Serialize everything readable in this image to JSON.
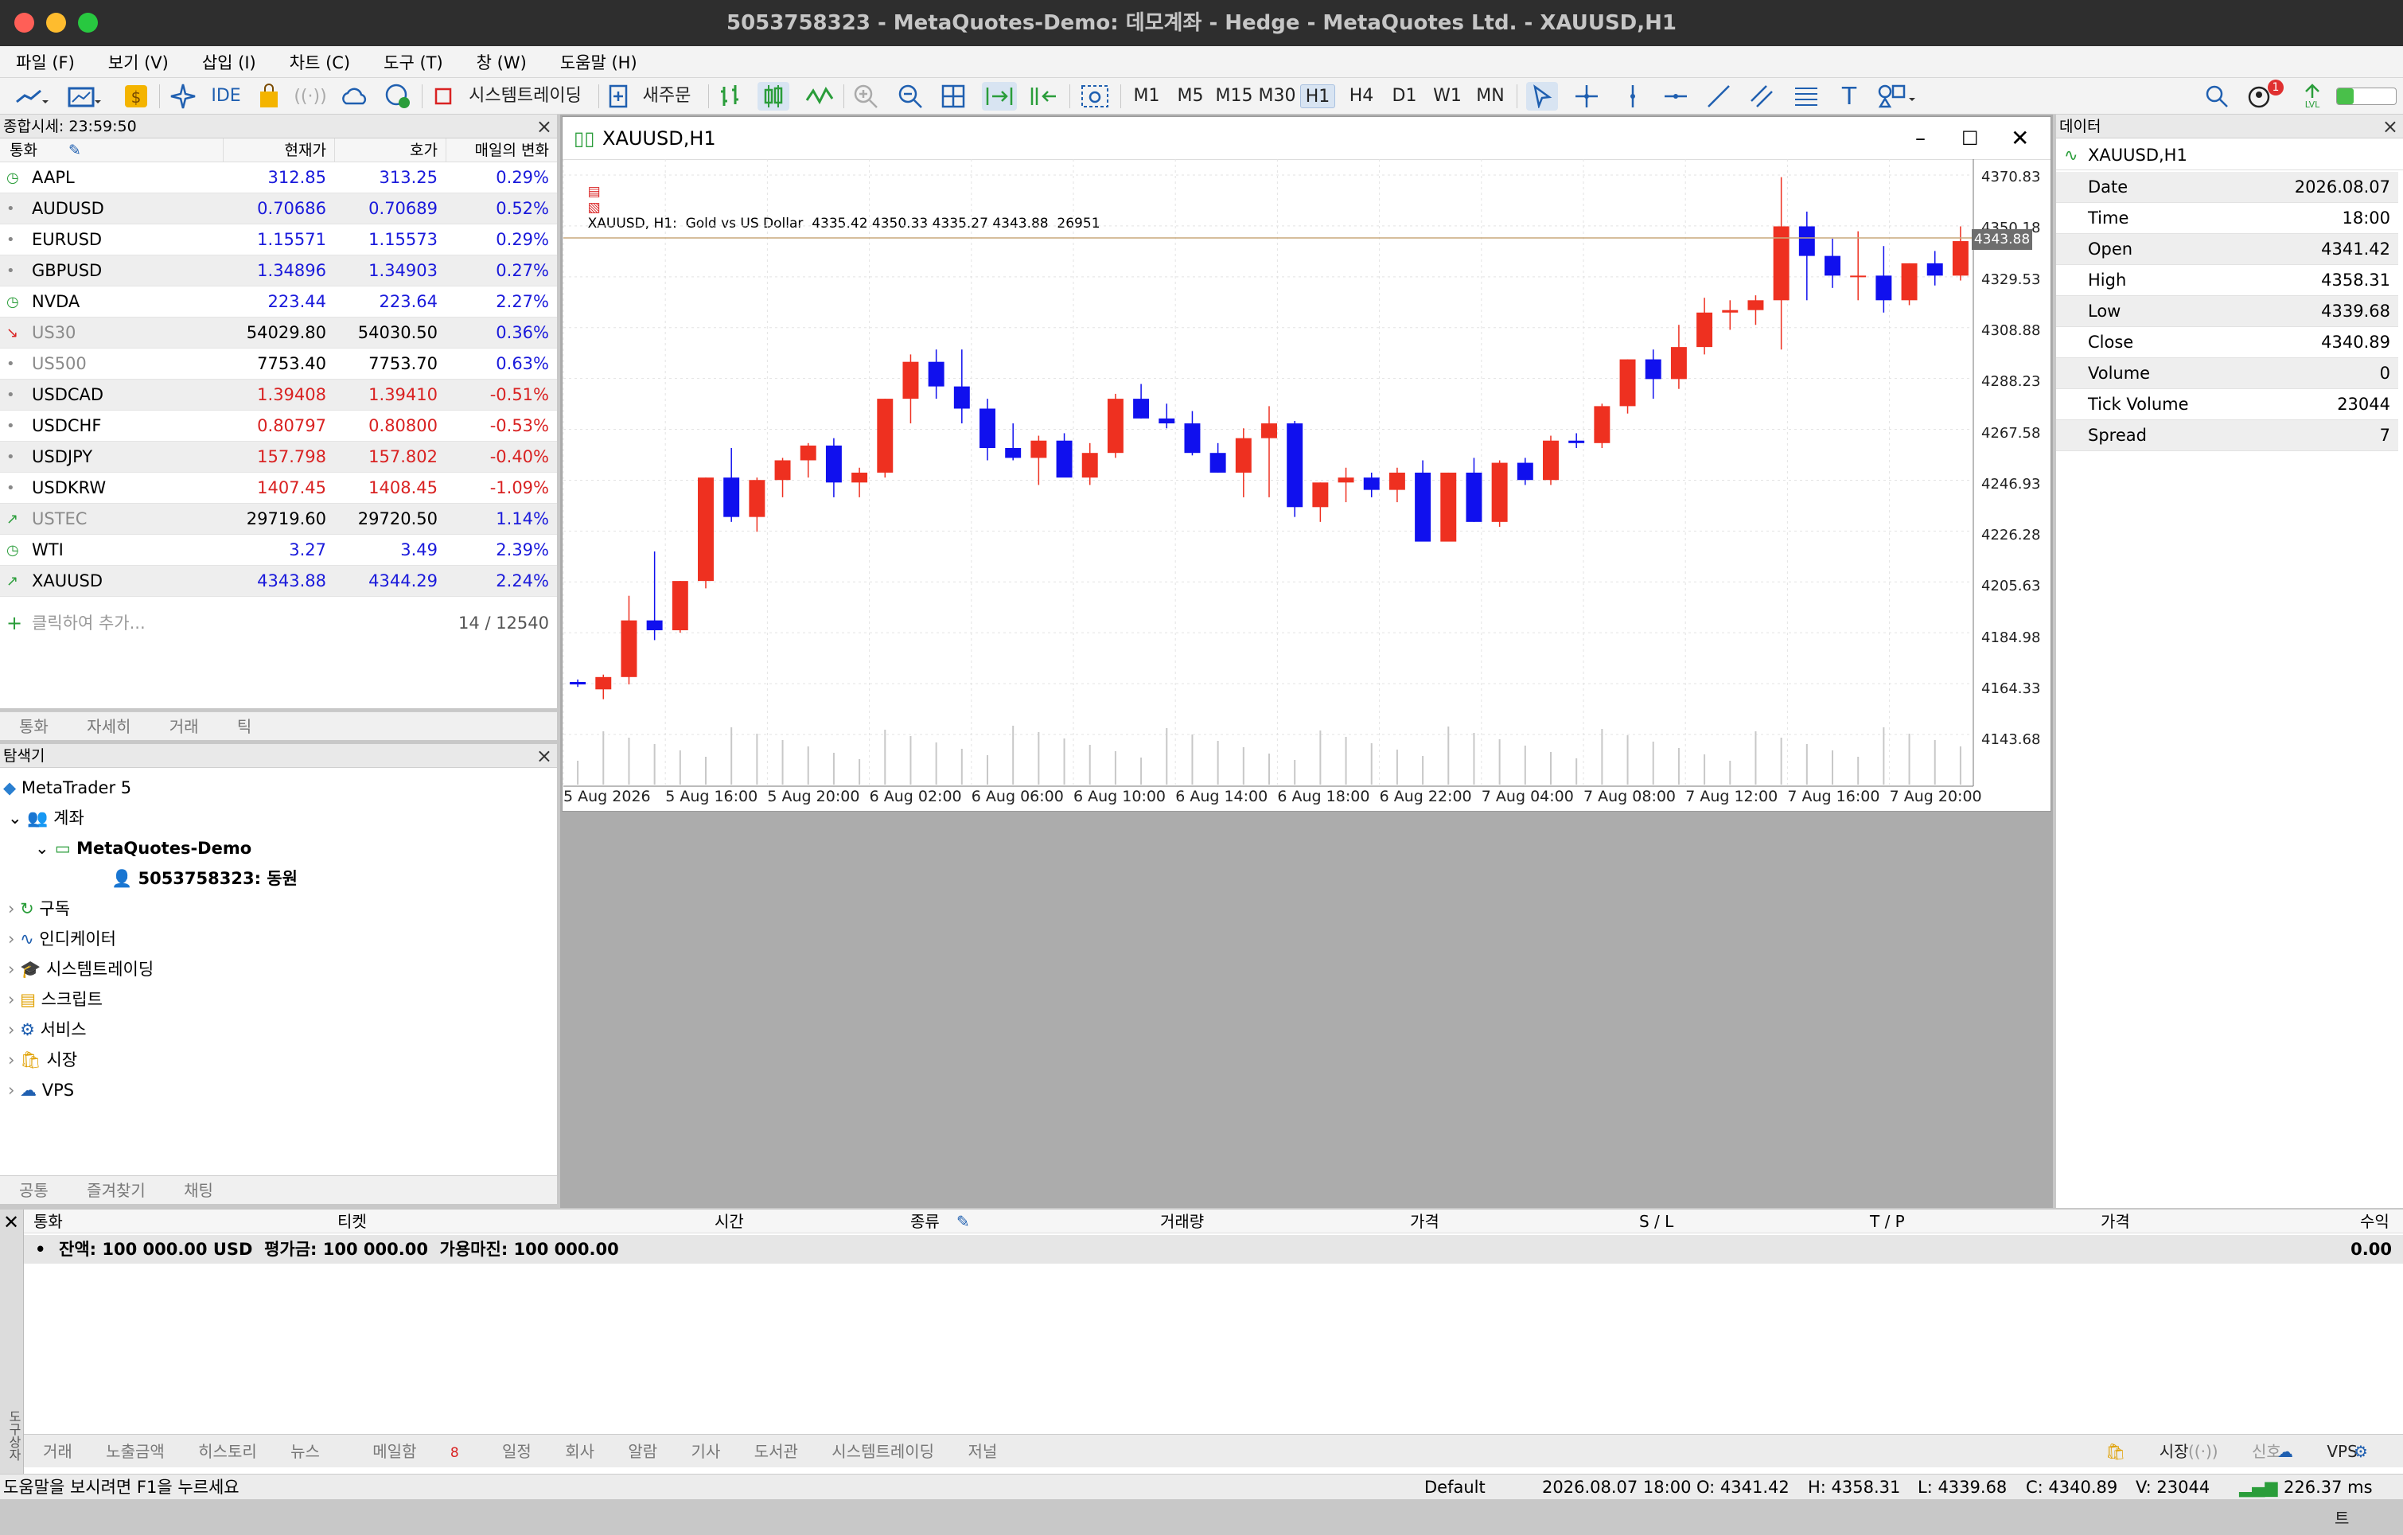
{
  "window": {
    "title": "5053758323 - MetaQuotes-Demo: 데모계좌 - Hedge - MetaQuotes Ltd. - XAUUSD,H1"
  },
  "menu": [
    "파일 (F)",
    "보기 (V)",
    "삽입 (I)",
    "차트 (C)",
    "도구 (T)",
    "창 (W)",
    "도움말 (H)"
  ],
  "toolbar": {
    "ide": "IDE",
    "algo_trading": "시스템트레이딩",
    "new_order": "새주문",
    "timeframes": [
      "M1",
      "M5",
      "M15",
      "M30",
      "H1",
      "H4",
      "D1",
      "W1",
      "MN"
    ],
    "active_timeframe": "H1",
    "notifications": "1",
    "lvl": "LVL"
  },
  "market_watch": {
    "title": "종합시세: 23:59:50",
    "columns": [
      "통화",
      "현재가",
      "호가",
      "매일의 변화"
    ],
    "rows": [
      {
        "symbol": "AAPL",
        "bid": "312.85",
        "ask": "313.25",
        "change": "0.29%",
        "dir": "up",
        "icon": "clock"
      },
      {
        "symbol": "AUDUSD",
        "bid": "0.70686",
        "ask": "0.70689",
        "change": "0.52%",
        "dir": "up",
        "icon": "dot"
      },
      {
        "symbol": "EURUSD",
        "bid": "1.15571",
        "ask": "1.15573",
        "change": "0.29%",
        "dir": "up",
        "icon": "dot"
      },
      {
        "symbol": "GBPUSD",
        "bid": "1.34896",
        "ask": "1.34903",
        "change": "0.27%",
        "dir": "up",
        "icon": "dot"
      },
      {
        "symbol": "NVDA",
        "bid": "223.44",
        "ask": "223.64",
        "change": "2.27%",
        "dir": "up",
        "icon": "clock"
      },
      {
        "symbol": "US30",
        "bid": "54029.80",
        "ask": "54030.50",
        "change": "0.36%",
        "dir": "gray",
        "icon": "arrow-down"
      },
      {
        "symbol": "US500",
        "bid": "7753.40",
        "ask": "7753.70",
        "change": "0.63%",
        "dir": "gray",
        "icon": "dot"
      },
      {
        "symbol": "USDCAD",
        "bid": "1.39408",
        "ask": "1.39410",
        "change": "-0.51%",
        "dir": "down",
        "icon": "dot"
      },
      {
        "symbol": "USDCHF",
        "bid": "0.80797",
        "ask": "0.80800",
        "change": "-0.53%",
        "dir": "down",
        "icon": "dot"
      },
      {
        "symbol": "USDJPY",
        "bid": "157.798",
        "ask": "157.802",
        "change": "-0.40%",
        "dir": "down",
        "icon": "dot"
      },
      {
        "symbol": "USDKRW",
        "bid": "1407.45",
        "ask": "1408.45",
        "change": "-1.09%",
        "dir": "down",
        "icon": "dot"
      },
      {
        "symbol": "USTEC",
        "bid": "29719.60",
        "ask": "29720.50",
        "change": "1.14%",
        "dir": "gray",
        "icon": "arrow-up"
      },
      {
        "symbol": "WTI",
        "bid": "3.27",
        "ask": "3.49",
        "change": "2.39%",
        "dir": "up",
        "icon": "clock"
      },
      {
        "symbol": "XAUUSD",
        "bid": "4343.88",
        "ask": "4344.29",
        "change": "2.24%",
        "dir": "up",
        "icon": "arrow-up"
      }
    ],
    "add_label": "클릭하여 추가...",
    "count": "14 / 12540",
    "tabs": [
      "통화",
      "자세히",
      "거래",
      "틱"
    ]
  },
  "navigator": {
    "title": "탐색기",
    "root": "MetaTrader 5",
    "accounts": "계좌",
    "server": "MetaQuotes-Demo",
    "account": "5053758323: 동원",
    "items": [
      "구독",
      "인디케이터",
      "시스템트레이딩",
      "스크립트",
      "서비스",
      "시장",
      "VPS"
    ],
    "tabs": [
      "공통",
      "즐겨찾기",
      "채팅"
    ]
  },
  "chart": {
    "window_title": "XAUUSD,H1",
    "info": "XAUUSD, H1:  Gold vs US Dollar  4335.42 4350.33 4335.27 4343.88  26951",
    "current_price": "4343.88",
    "price_labels": [
      "4370.83",
      "4350.18",
      "4329.53",
      "4308.88",
      "4288.23",
      "4267.58",
      "4246.93",
      "4226.28",
      "4205.63",
      "4184.98",
      "4164.33",
      "4143.68"
    ],
    "time_labels": [
      "5 Aug 2026",
      "5 Aug 16:00",
      "5 Aug 20:00",
      "6 Aug 02:00",
      "6 Aug 06:00",
      "6 Aug 10:00",
      "6 Aug 14:00",
      "6 Aug 18:00",
      "6 Aug 22:00",
      "7 Aug 04:00",
      "7 Aug 08:00",
      "7 Aug 12:00",
      "7 Aug 16:00",
      "7 Aug 20:00"
    ]
  },
  "chart_data": {
    "type": "candlestick",
    "title": "XAUUSD, H1",
    "ylim": [
      4143.68,
      4370.83
    ],
    "candles": [
      [
        4165,
        4166,
        4163,
        4164
      ],
      [
        4162,
        4168,
        4158,
        4167
      ],
      [
        4167,
        4200,
        4164,
        4190
      ],
      [
        4190,
        4218,
        4182,
        4186
      ],
      [
        4186,
        4206,
        4185,
        4206
      ],
      [
        4206,
        4248,
        4203,
        4248
      ],
      [
        4248,
        4260,
        4230,
        4232
      ],
      [
        4232,
        4248,
        4226,
        4247
      ],
      [
        4247,
        4256,
        4240,
        4255
      ],
      [
        4255,
        4262,
        4248,
        4261
      ],
      [
        4261,
        4264,
        4240,
        4246
      ],
      [
        4246,
        4252,
        4240,
        4250
      ],
      [
        4250,
        4280,
        4248,
        4280
      ],
      [
        4280,
        4298,
        4270,
        4295
      ],
      [
        4295,
        4300,
        4280,
        4285
      ],
      [
        4285,
        4300,
        4270,
        4276
      ],
      [
        4276,
        4280,
        4255,
        4260
      ],
      [
        4260,
        4270,
        4255,
        4256
      ],
      [
        4256,
        4265,
        4245,
        4263
      ],
      [
        4263,
        4266,
        4250,
        4248
      ],
      [
        4248,
        4262,
        4245,
        4258
      ],
      [
        4258,
        4282,
        4256,
        4280
      ],
      [
        4280,
        4286,
        4272,
        4272
      ],
      [
        4272,
        4278,
        4268,
        4270
      ],
      [
        4270,
        4275,
        4257,
        4258
      ],
      [
        4258,
        4262,
        4250,
        4250
      ],
      [
        4250,
        4268,
        4240,
        4264
      ],
      [
        4264,
        4277,
        4240,
        4270
      ],
      [
        4270,
        4271,
        4232,
        4236
      ],
      [
        4236,
        4246,
        4230,
        4246
      ],
      [
        4246,
        4252,
        4238,
        4248
      ],
      [
        4248,
        4250,
        4240,
        4243
      ],
      [
        4243,
        4252,
        4238,
        4250
      ],
      [
        4250,
        4255,
        4225,
        4222
      ],
      [
        4222,
        4250,
        4225,
        4250
      ],
      [
        4250,
        4256,
        4230,
        4230
      ],
      [
        4230,
        4255,
        4228,
        4254
      ],
      [
        4254,
        4256,
        4245,
        4247
      ],
      [
        4247,
        4265,
        4245,
        4263
      ],
      [
        4263,
        4266,
        4260,
        4262
      ],
      [
        4262,
        4278,
        4260,
        4277
      ],
      [
        4277,
        4296,
        4274,
        4296
      ],
      [
        4296,
        4300,
        4280,
        4288
      ],
      [
        4288,
        4310,
        4284,
        4301
      ],
      [
        4301,
        4321,
        4298,
        4315
      ],
      [
        4315,
        4320,
        4308,
        4316
      ],
      [
        4316,
        4322,
        4310,
        4320
      ],
      [
        4320,
        4370,
        4300,
        4350
      ],
      [
        4350,
        4356,
        4320,
        4338
      ],
      [
        4338,
        4345,
        4325,
        4330
      ],
      [
        4330,
        4348,
        4320,
        4330
      ],
      [
        4330,
        4342,
        4315,
        4320
      ],
      [
        4320,
        4335,
        4318,
        4335
      ],
      [
        4335,
        4340,
        4326,
        4330
      ],
      [
        4330,
        4350,
        4328,
        4344
      ]
    ]
  },
  "data_window": {
    "title": "데이터",
    "symbol": "XAUUSD,H1",
    "rows": [
      {
        "label": "Date",
        "value": "2026.08.07"
      },
      {
        "label": "Time",
        "value": "18:00"
      },
      {
        "label": "Open",
        "value": "4341.42"
      },
      {
        "label": "High",
        "value": "4358.31"
      },
      {
        "label": "Low",
        "value": "4339.68"
      },
      {
        "label": "Close",
        "value": "4340.89"
      },
      {
        "label": "Volume",
        "value": "0"
      },
      {
        "label": "Tick Volume",
        "value": "23044"
      },
      {
        "label": "Spread",
        "value": "7"
      }
    ]
  },
  "toolbox": {
    "columns": [
      "통화",
      "티켓",
      "시간",
      "종류",
      "거래량",
      "가격",
      "S / L",
      "T / P",
      "가격",
      "수익"
    ],
    "balance": "잔액: 100 000.00 USD  평가금: 100 000.00  가용마진: 100 000.00",
    "balance_profit": "0.00",
    "tabs": [
      "거래",
      "노출금액",
      "히스토리",
      "뉴스",
      "메일함",
      "일정",
      "회사",
      "알람",
      "기사",
      "도서관",
      "시스템트레이딩",
      "저널"
    ],
    "mail_count": "8",
    "side_label": "도구상자",
    "right_items": [
      "시장",
      "신호",
      "VPS",
      "테스트"
    ]
  },
  "status": {
    "help": "도움말을 보시려면 F1을 누르세요",
    "profile": "Default",
    "datetime": "2026.08.07 18:00",
    "open": "O: 4341.42",
    "high": "H: 4358.31",
    "low": "L: 4339.68",
    "close": "C: 4340.89",
    "volume": "V: 23044",
    "ping": "226.37 ms"
  },
  "colors": {
    "bull": "#ee3020",
    "bear": "#1010ee",
    "price_line": "#c8a87c"
  }
}
